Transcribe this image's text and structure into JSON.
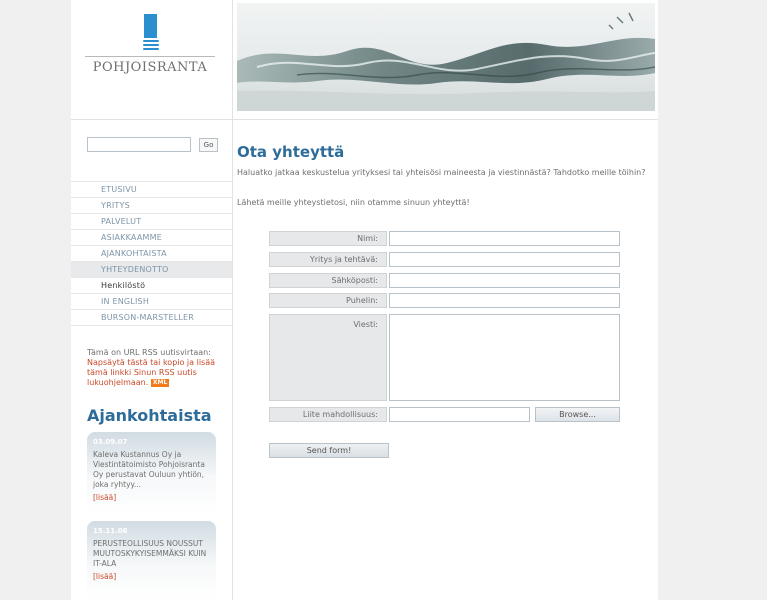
{
  "brand": {
    "name": "POHJOISRANTA"
  },
  "search": {
    "placeholder": "",
    "value": "",
    "go_label": "Go"
  },
  "nav": {
    "items": [
      {
        "label": "ETUSIVU"
      },
      {
        "label": "YRITYS"
      },
      {
        "label": "PALVELUT"
      },
      {
        "label": "ASIAKKAAMME"
      },
      {
        "label": "AJANKOHTAISTA"
      },
      {
        "label": "YHTEYDENOTTO"
      },
      {
        "label": "Henkilöstö"
      },
      {
        "label": "IN ENGLISH"
      },
      {
        "label": "BURSON-MARSTELLER"
      }
    ]
  },
  "rss": {
    "intro": "Tämä on URL RSS uutisvirtaan:",
    "link": "Napsäytä tästä tai kopio ja lisää tämä linkki Sinun RSS uutis lukuohjelmaan.",
    "badge": "XML"
  },
  "news": {
    "heading": "Ajankohtaista",
    "items": [
      {
        "date": "03.09.07",
        "text": "Kaleva Kustannus Oy ja Viestintätoimisto Pohjoisranta Oy perustavat Ouluun yhtiön, joka ryhtyy...",
        "more": "[lisää]"
      },
      {
        "date": "15.11.06",
        "text": "PERUSTEOLLISUUS NOUSSUT MUUTOSKYKYISEMMÄKSI KUIN IT-ALA",
        "more": "[lisää]"
      }
    ]
  },
  "content": {
    "title": "Ota yhteyttä",
    "intro": "Haluatko jatkaa keskustelua yrityksesi tai yhteisösi maineesta ja viestinnästä? Tahdotko meille töihin?",
    "instruction": "Lähetä meille yhteystietosi, niin otamme sinuun yhteyttä!"
  },
  "form": {
    "fields": [
      {
        "label": "Nimi:",
        "value": ""
      },
      {
        "label": "Yritys ja tehtävä:",
        "value": ""
      },
      {
        "label": "Sähköposti:",
        "value": ""
      },
      {
        "label": "Puhelin:",
        "value": ""
      },
      {
        "label": "Viesti:",
        "value": ""
      },
      {
        "label": "Liite mahdollisuus:",
        "value": ""
      }
    ],
    "browse_label": "Browse...",
    "submit_label": "Send form!"
  },
  "colors": {
    "accent": "#2e6c9a",
    "nav_text": "#7d95a8",
    "link": "#c8492a",
    "logo_blue": "#2b8fcf"
  }
}
